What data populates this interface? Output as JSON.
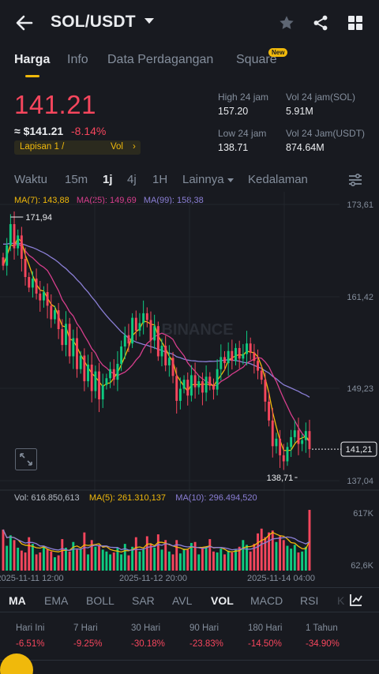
{
  "header": {
    "title": "SOL/USDT"
  },
  "tabs": [
    {
      "label": "Harga"
    },
    {
      "label": "Info"
    },
    {
      "label": "Data Perdagangan"
    },
    {
      "label": "Square",
      "badge": "New"
    }
  ],
  "price": {
    "last": "141.21",
    "approx": "≈ $141.21",
    "change_pct": "-8.14%",
    "layer_label": "Lapisan 1 /",
    "vol_label": "Vol",
    "vol_arrow": "›"
  },
  "stats": {
    "high_label": "High 24 jam",
    "high_value": "157.20",
    "low_label": "Low 24 jam",
    "low_value": "138.71",
    "vol_sol_label": "Vol 24 jam(SOL)",
    "vol_sol_value": "5.91M",
    "vol_usdt_label": "Vol 24 Jam(USDT)",
    "vol_usdt_value": "874.64M"
  },
  "intervals": [
    {
      "label": "Waktu"
    },
    {
      "label": "15m"
    },
    {
      "label": "1j"
    },
    {
      "label": "4j"
    },
    {
      "label": "1H"
    },
    {
      "label": "Lainnya"
    },
    {
      "label": "Kedalaman"
    }
  ],
  "ma_legend": {
    "ma7": "MA(7): 143,88",
    "ma25": "MA(25): 149,69",
    "ma99": "MA(99): 158,38"
  },
  "vol_legend": {
    "vol": "Vol: 616.850,613",
    "ma5": "MA(5): 261.310,137",
    "ma10": "MA(10): 296.494,520"
  },
  "price_axis": [
    "173,61",
    "161,42",
    "149,23",
    "137,04"
  ],
  "vol_axis": [
    "617K",
    "62,6K"
  ],
  "time_axis": [
    "2025-11-11 12:00",
    "2025-11-12 20:00",
    "2025-11-14 04:00"
  ],
  "annotations": {
    "high_marker": "171,94",
    "low_marker": "138,71",
    "current_price_tag": "141,21"
  },
  "watermark": "BINANCE",
  "indicators": [
    {
      "label": "MA"
    },
    {
      "label": "EMA"
    },
    {
      "label": "BOLL"
    },
    {
      "label": "SAR"
    },
    {
      "label": "AVL"
    },
    {
      "label": "VOL"
    },
    {
      "label": "MACD"
    },
    {
      "label": "RSI"
    },
    {
      "label": "K"
    }
  ],
  "performance": [
    {
      "label": "Hari Ini",
      "value": "-6.51%"
    },
    {
      "label": "7 Hari",
      "value": "-9.25%"
    },
    {
      "label": "30 Hari",
      "value": "-30.18%"
    },
    {
      "label": "90 Hari",
      "value": "-23.83%"
    },
    {
      "label": "180 Hari",
      "value": "-14.50%"
    },
    {
      "label": "1 Tahun",
      "value": "-34.90%"
    }
  ],
  "colors": {
    "up": "#0ecb81",
    "down": "#f6465d",
    "accent": "#f0b90b",
    "ma7": "#f0b90b",
    "ma25": "#d63e8c",
    "ma99": "#8b7fd6",
    "background": "#181a20"
  },
  "chart_data": {
    "type": "candlestick",
    "interval": "1j",
    "price_ticks": [
      173.61,
      161.42,
      149.23,
      137.04
    ],
    "volume_ticks": [
      617000,
      62600
    ],
    "period_high": 171.94,
    "period_low": 138.71,
    "last_price": 141.21,
    "ma_latest": {
      "ma7": 143.88,
      "ma25": 149.69,
      "ma99": 158.38
    },
    "volume_latest": {
      "vol": 616850.613,
      "ma5": 261310.137,
      "ma10": 296494.52
    },
    "closes": [
      165.5,
      168.2,
      171.0,
      167.8,
      169.5,
      166.4,
      164.0,
      162.6,
      163.8,
      161.8,
      160.9,
      162.0,
      160.2,
      158.4,
      159.6,
      157.1,
      155.0,
      157.8,
      153.5,
      155.9,
      151.8,
      153.6,
      150.2,
      152.4,
      148.9,
      151.5,
      147.8,
      149.7,
      150.6,
      151.8,
      150.4,
      152.5,
      154.8,
      156.3,
      155.2,
      158.6,
      156.9,
      157.9,
      159.2,
      158.3,
      155.6,
      157.5,
      153.5,
      154.9,
      152.3,
      153.3,
      150.9,
      147.6,
      149.2,
      150.4,
      148.3,
      151.0,
      149.4,
      150.2,
      148.7,
      150.8,
      149.6,
      149.1,
      151.8,
      153.4,
      152.6,
      154.2,
      152.9,
      154.6,
      153.2,
      153.8,
      155.2,
      154.0,
      152.9,
      151.6,
      150.4,
      147.5,
      145.0,
      141.6,
      142.6,
      140.4,
      139.6,
      141.5,
      142.8,
      143.7,
      141.9,
      142.4,
      143.6,
      141.21
    ],
    "volumes": [
      410000,
      240000,
      350000,
      300000,
      220000,
      190000,
      170000,
      330000,
      260000,
      150000,
      170000,
      240000,
      200000,
      180000,
      120000,
      140000,
      310000,
      220000,
      180000,
      280000,
      200000,
      210000,
      380000,
      150000,
      300000,
      230000,
      250000,
      200000,
      180000,
      150000,
      170000,
      220000,
      150000,
      260000,
      140000,
      230000,
      330000,
      180000,
      200000,
      340000,
      260000,
      220000,
      360000,
      200000,
      300000,
      180000,
      150000,
      300000,
      160000,
      210000,
      200000,
      270000,
      280000,
      150000,
      220000,
      230000,
      310000,
      180000,
      170000,
      210000,
      150000,
      190000,
      170000,
      200000,
      230000,
      300000,
      250000,
      180000,
      260000,
      370000,
      420000,
      330000,
      380000,
      400000,
      280000,
      340000,
      300000,
      240000,
      210000,
      250000,
      170000,
      180000,
      230000,
      616850
    ]
  }
}
